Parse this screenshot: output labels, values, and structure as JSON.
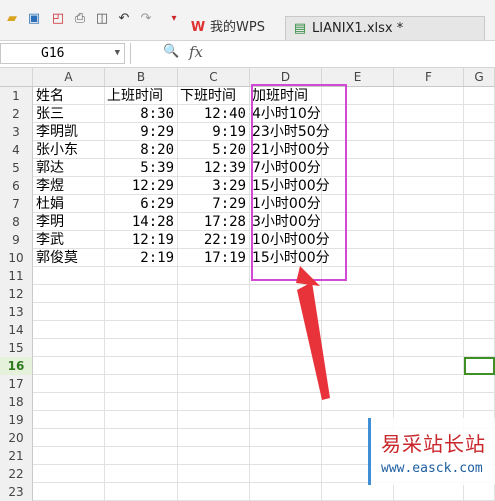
{
  "toolbar": {
    "icons": [
      "folder-open-icon",
      "save-icon",
      "export-pdf-icon",
      "print-icon",
      "print-preview-icon",
      "undo-icon",
      "redo-icon",
      "dropdown-icon"
    ],
    "tabs": [
      {
        "label": "我的WPS",
        "icon": "wps-logo-icon"
      },
      {
        "label": "LIANIX1.xlsx *",
        "icon": "spreadsheet-file-icon"
      }
    ]
  },
  "formula_bar": {
    "cell_ref": "G16",
    "fx_label": "fx",
    "value": ""
  },
  "columns": [
    "A",
    "B",
    "C",
    "D",
    "E",
    "F",
    "G"
  ],
  "rows": [
    {
      "n": "1",
      "A": "姓名",
      "B": "上班时间",
      "C": "下班时间",
      "D": "加班时间"
    },
    {
      "n": "2",
      "A": "张三",
      "B": "8:30",
      "C": "12:40",
      "D": "4小时10分"
    },
    {
      "n": "3",
      "A": "李明凯",
      "B": "9:29",
      "C": "9:19",
      "D": "23小时50分"
    },
    {
      "n": "4",
      "A": "张小东",
      "B": "8:20",
      "C": "5:20",
      "D": "21小时00分"
    },
    {
      "n": "5",
      "A": "郭达",
      "B": "5:39",
      "C": "12:39",
      "D": "7小时00分"
    },
    {
      "n": "6",
      "A": "李煜",
      "B": "12:29",
      "C": "3:29",
      "D": "15小时00分"
    },
    {
      "n": "7",
      "A": "杜娟",
      "B": "6:29",
      "C": "7:29",
      "D": "1小时00分"
    },
    {
      "n": "8",
      "A": "李明",
      "B": "14:28",
      "C": "17:28",
      "D": "3小时00分"
    },
    {
      "n": "9",
      "A": "李武",
      "B": "12:19",
      "C": "22:19",
      "D": "10小时00分"
    },
    {
      "n": "10",
      "A": "郭俊莫",
      "B": "2:19",
      "C": "17:19",
      "D": "15小时00分"
    },
    {
      "n": "11"
    },
    {
      "n": "12"
    },
    {
      "n": "13"
    },
    {
      "n": "14"
    },
    {
      "n": "15"
    },
    {
      "n": "16",
      "selected": true
    },
    {
      "n": "17"
    },
    {
      "n": "18"
    },
    {
      "n": "19"
    },
    {
      "n": "20"
    },
    {
      "n": "21"
    },
    {
      "n": "22"
    },
    {
      "n": "23"
    }
  ],
  "annotation": {
    "highlight_color": "#d14ad6",
    "arrow_color": "#e8333a"
  },
  "watermark": {
    "title": "易采站长站",
    "url": "www.easck.com"
  },
  "colors": {
    "selection": "#3e8f24"
  }
}
